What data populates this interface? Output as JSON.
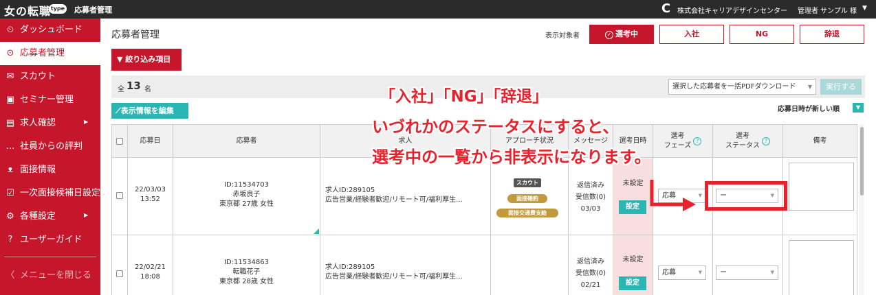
{
  "topbar": {
    "logo": "女の転職",
    "logo_badge": "type",
    "title": "応募者管理",
    "company": "株式会社キャリアデザインセンター",
    "admin": "管理者 サンプル 様",
    "caret": "▼"
  },
  "sidebar": {
    "items": [
      {
        "label": "ダッシュボード",
        "icon": "dashboard-icon",
        "glyph": "⏲"
      },
      {
        "label": "応募者管理",
        "icon": "user-search-icon",
        "glyph": "⊙"
      },
      {
        "label": "スカウト",
        "icon": "envelope-icon",
        "glyph": "✉"
      },
      {
        "label": "セミナー管理",
        "icon": "seminar-icon",
        "glyph": "▣"
      },
      {
        "label": "求人確認",
        "icon": "job-icon",
        "glyph": "▤"
      },
      {
        "label": "社員からの評判",
        "icon": "chat-icon",
        "glyph": "…"
      },
      {
        "label": "面接情報",
        "icon": "people-icon",
        "glyph": "ᴥ"
      },
      {
        "label": "一次面接候補日設定",
        "icon": "calendar-check-icon",
        "glyph": "☑"
      },
      {
        "label": "各種設定",
        "icon": "gear-icon",
        "glyph": "⚙"
      },
      {
        "label": "ユーザーガイド",
        "icon": "help-icon",
        "glyph": "?"
      }
    ],
    "close_label": "メニューを閉じる",
    "close_glyph": "〈"
  },
  "main": {
    "page_title": "応募者管理",
    "filter_label": "表示対象者",
    "filter_buttons": [
      "選考中",
      "入社",
      "NG",
      "辞退"
    ],
    "narrow_button": "▼ 絞り込み項目",
    "count_prefix": "全",
    "count": "13",
    "count_unit": "名",
    "pdf_select": "選択した応募者を一括PDFダウンロード",
    "run_button": "実行する",
    "edit_button": "⟋表示情報を編集",
    "sort_label": "応募日時が新しい順",
    "sort_caret": "▼"
  },
  "table": {
    "headers": {
      "date": "応募日",
      "applicant": "応募者",
      "job": "求人",
      "approach": "アプローチ状況",
      "message": "メッセージ",
      "schedule": "選考日時",
      "phase": [
        "選考",
        "フェーズ"
      ],
      "status": [
        "選考",
        "ステータス"
      ],
      "memo": "備考"
    },
    "rows": [
      {
        "date": [
          "22/03/03",
          "13:52"
        ],
        "applicant": [
          "ID:11534703",
          "赤坂良子",
          "東京都 27歳 女性"
        ],
        "job": [
          "求人ID:289105",
          "広告営業/経験者歓迎/リモート可/福利厚生..."
        ],
        "tags": [
          "スカウト",
          "面接確約",
          "面接交通費支給"
        ],
        "message": [
          "返信済み",
          "受信数(0)",
          "03/03"
        ],
        "schedule": "未設定",
        "set_button": "設定",
        "phase": "応募",
        "status": "ー"
      },
      {
        "date": [
          "22/02/21",
          "18:08"
        ],
        "applicant": [
          "ID:11534863",
          "転職花子",
          "東京都 28歳 女性"
        ],
        "job": [
          "求人ID:289105",
          "広告営業/経験者歓迎/リモート可/福利厚生..."
        ],
        "tags": [],
        "message": [
          "返信済み",
          "受信数(0)",
          "02/21"
        ],
        "schedule": "未設定",
        "set_button": "設定",
        "phase": "応募",
        "status": "ー"
      }
    ]
  },
  "annotation": {
    "line1": "「入社」「NG」「辞退」",
    "line2": "いづれかのステータスにすると、",
    "line3": "選考中の一覧から非表示になります。",
    "color": "#e8222c"
  },
  "colors": {
    "brand_red": "#c6162c",
    "teal": "#2cb6b3",
    "topbar": "#2b2b2b"
  }
}
